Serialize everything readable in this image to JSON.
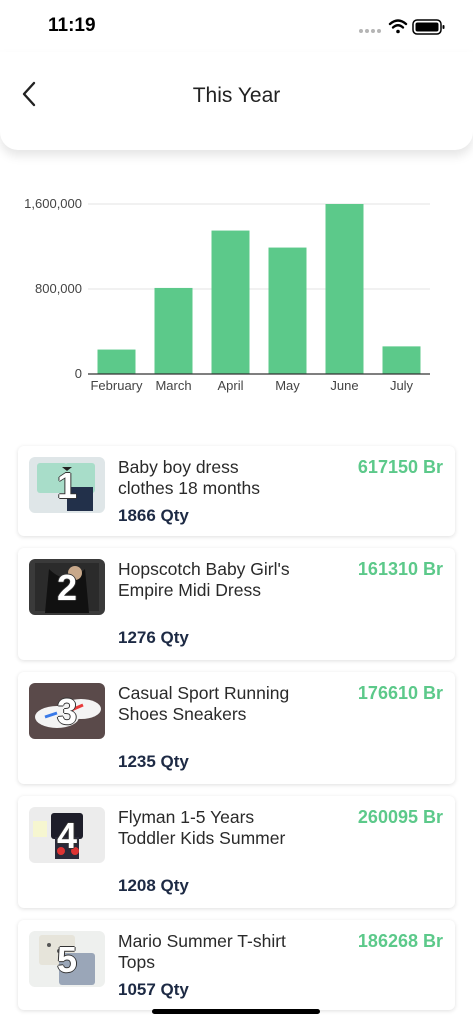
{
  "status_bar": {
    "time": "11:19"
  },
  "header": {
    "title": "This Year"
  },
  "chart_data": {
    "type": "bar",
    "categories": [
      "February",
      "March",
      "April",
      "May",
      "June",
      "July"
    ],
    "values": [
      230000,
      810000,
      1350000,
      1190000,
      1600000,
      260000
    ],
    "yticks": [
      "0",
      "800,000",
      "1,600,000"
    ],
    "ylim": [
      0,
      1600000
    ],
    "color": "#5cc98a",
    "grid": true
  },
  "products": [
    {
      "rank": "1",
      "name": "Baby boy dress clothes 18 months",
      "qty": "1866 Qty",
      "amount": "617150 Br",
      "icon": "kids-outfit-thumbnail"
    },
    {
      "rank": "2",
      "name": "Hopscotch Baby Girl's Empire Midi Dress",
      "qty": "1276 Qty",
      "amount": "161310 Br",
      "icon": "dress-thumbnail"
    },
    {
      "rank": "3",
      "name": "Casual Sport Running Shoes Sneakers",
      "qty": "1235 Qty",
      "amount": "176610 Br",
      "icon": "sneakers-thumbnail"
    },
    {
      "rank": "4",
      "name": "Flyman 1-5 Years Toddler Kids Summer",
      "qty": "1208 Qty",
      "amount": "260095 Br",
      "icon": "toddler-outfit-thumbnail"
    },
    {
      "rank": "5",
      "name": "Mario Summer T-shirt Tops",
      "qty": "1057 Qty",
      "amount": "186268 Br",
      "icon": "tshirt-thumbnail"
    }
  ]
}
